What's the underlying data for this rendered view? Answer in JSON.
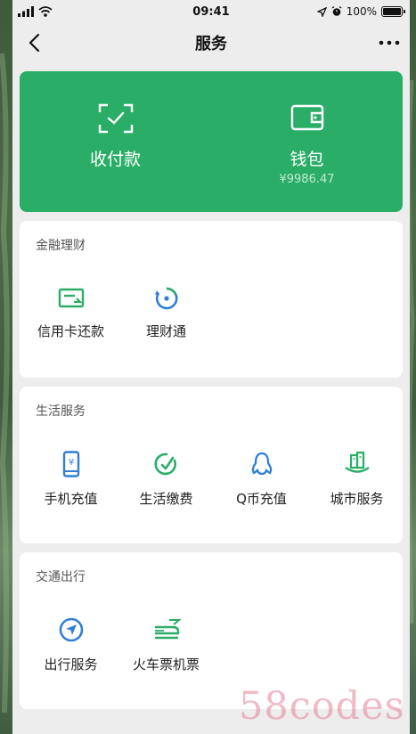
{
  "status": {
    "time": "09:41",
    "battery": "100%"
  },
  "nav": {
    "title": "服务"
  },
  "hero": {
    "pay": {
      "label": "收付款",
      "icon": "scan-check-icon"
    },
    "wallet": {
      "label": "钱包",
      "balance": "¥9986.47",
      "icon": "wallet-icon"
    }
  },
  "sections": {
    "finance": {
      "title": "金融理财",
      "items": [
        {
          "label": "信用卡还款",
          "icon": "credit-card-icon"
        },
        {
          "label": "理财通",
          "icon": "wealth-icon"
        }
      ]
    },
    "life": {
      "title": "生活服务",
      "items": [
        {
          "label": "手机充值",
          "icon": "phone-recharge-icon"
        },
        {
          "label": "生活缴费",
          "icon": "utility-payment-icon"
        },
        {
          "label": "Q币充值",
          "icon": "qq-penguin-icon"
        },
        {
          "label": "城市服务",
          "icon": "city-service-icon"
        }
      ]
    },
    "travel": {
      "title": "交通出行",
      "items": [
        {
          "label": "出行服务",
          "icon": "navigation-icon"
        },
        {
          "label": "火车票机票",
          "icon": "train-plane-icon"
        }
      ]
    }
  },
  "watermark": "58codes",
  "colors": {
    "accent": "#2aae67",
    "blue": "#2f7fd8",
    "green": "#2aae67"
  }
}
